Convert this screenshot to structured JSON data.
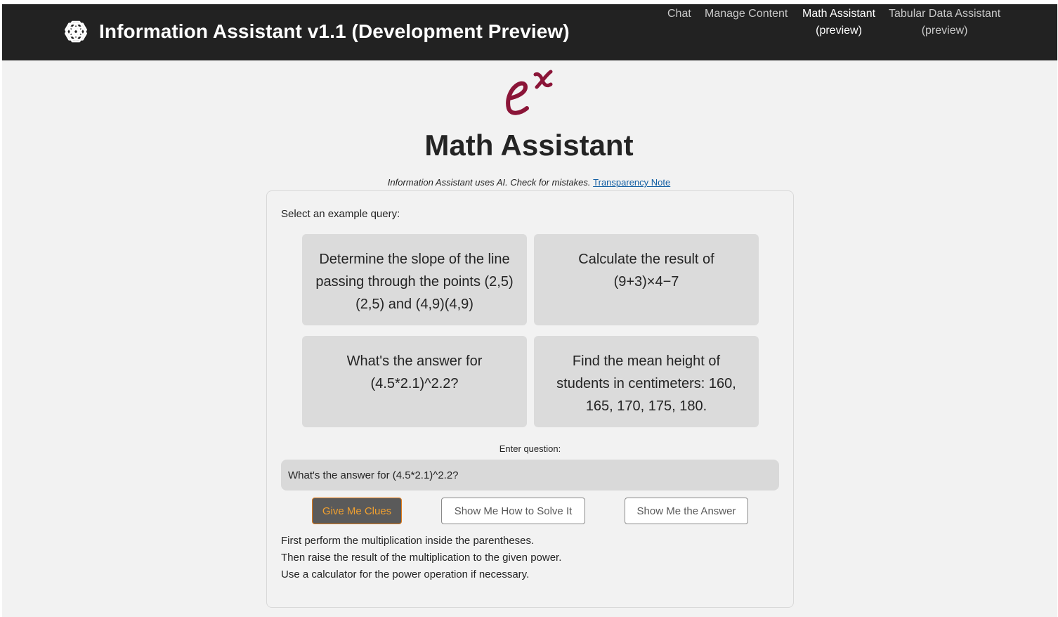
{
  "header": {
    "app_title": "Information Assistant v1.1 (Development Preview)",
    "logo_icon": "openai-knot-icon",
    "background": "#222222",
    "nav": [
      {
        "label": "Chat",
        "sub": ""
      },
      {
        "label": "Manage Content",
        "sub": ""
      },
      {
        "label": "Math Assistant",
        "sub": "(preview)"
      },
      {
        "label": "Tabular Data Assistant",
        "sub": "(preview)"
      }
    ]
  },
  "page": {
    "logo_icon": "e-to-the-x-icon",
    "logo_color": "#8b1538",
    "title": "Math Assistant",
    "disclaimer": "Information Assistant uses AI. Check for mistakes.",
    "disclaimer_link": "Transparency Note"
  },
  "panel": {
    "select_label": "Select an example query:",
    "examples": [
      "Determine the slope of the line passing through the points (2,5)(2,5) and (4,9)(4,9)",
      "Calculate the result of (9+3)×4−7",
      "What's the answer for (4.5*2.1)^2.2?",
      "Find the mean height of students in centimeters: 160, 165, 170, 175, 180."
    ],
    "enter_label": "Enter question:",
    "question_value": "What's the answer for (4.5*2.1)^2.2?",
    "question_placeholder": "",
    "buttons": {
      "clues": "Give Me Clues",
      "solve": "Show Me How to Solve It",
      "answer": "Show Me the Answer"
    },
    "accent_color": "#e07b1a",
    "clues": [
      "First perform the multiplication inside the parentheses.",
      "Then raise the result of the multiplication to the given power.",
      "Use a calculator for the power operation if necessary."
    ]
  }
}
